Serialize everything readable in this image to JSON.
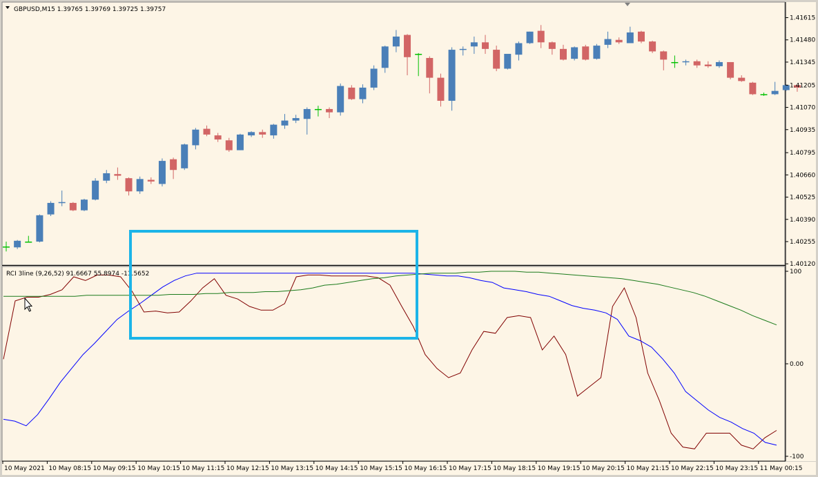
{
  "window": {
    "symbol_header": "GBPUSD,M15  1.39765 1.39769 1.39725 1.39757",
    "indicator_header": "RCI 3line (9,26,52) 91.6667 55.8974 -11.5652"
  },
  "colors": {
    "background": "#fdf5e6",
    "bull": "#4a7fb8",
    "bear": "#d26565",
    "doji": "#00c000",
    "rci_short": "#800000",
    "rci_mid": "#0000ff",
    "rci_long": "#1a7a1a",
    "highlight_box": "#1cb4e8"
  },
  "chart_data": [
    {
      "type": "candlestick",
      "title": "GBPUSD,M15",
      "ylim": [
        1.40125,
        1.41655
      ],
      "y_ticks": [
        "1.41615",
        "1.41480",
        "1.41345",
        "1.41205",
        "1.41070",
        "1.40935",
        "1.40795",
        "1.40660",
        "1.40525",
        "1.40390",
        "1.40255",
        "1.40120"
      ],
      "x_ticks": [
        "10 May 2021",
        "10 May 08:15",
        "10 May 09:15",
        "10 May 10:15",
        "10 May 11:15",
        "10 May 12:15",
        "10 May 13:15",
        "10 May 14:15",
        "10 May 15:15",
        "10 May 16:15",
        "10 May 17:15",
        "10 May 18:15",
        "10 May 19:15",
        "10 May 20:15",
        "10 May 21:15",
        "10 May 22:15",
        "10 May 23:15",
        "11 May 00:15"
      ],
      "candles": [
        {
          "o": 1.40225,
          "h": 1.40255,
          "l": 1.40195,
          "c": 1.40225
        },
        {
          "o": 1.4022,
          "h": 1.40265,
          "l": 1.4021,
          "c": 1.4026
        },
        {
          "o": 1.40255,
          "h": 1.4029,
          "l": 1.40255,
          "c": 1.40255
        },
        {
          "o": 1.40255,
          "h": 1.4042,
          "l": 1.4025,
          "c": 1.40415
        },
        {
          "o": 1.4042,
          "h": 1.405,
          "l": 1.4041,
          "c": 1.4049
        },
        {
          "o": 1.4049,
          "h": 1.40565,
          "l": 1.4047,
          "c": 1.40495
        },
        {
          "o": 1.4049,
          "h": 1.40495,
          "l": 1.4044,
          "c": 1.40445
        },
        {
          "o": 1.40445,
          "h": 1.40515,
          "l": 1.4044,
          "c": 1.4051
        },
        {
          "o": 1.4051,
          "h": 1.4064,
          "l": 1.40505,
          "c": 1.40625
        },
        {
          "o": 1.40625,
          "h": 1.4069,
          "l": 1.4061,
          "c": 1.4067
        },
        {
          "o": 1.40665,
          "h": 1.40705,
          "l": 1.4063,
          "c": 1.40655
        },
        {
          "o": 1.4064,
          "h": 1.40645,
          "l": 1.40535,
          "c": 1.4056
        },
        {
          "o": 1.4056,
          "h": 1.4065,
          "l": 1.40545,
          "c": 1.40635
        },
        {
          "o": 1.4063,
          "h": 1.40645,
          "l": 1.40605,
          "c": 1.4062
        },
        {
          "o": 1.40605,
          "h": 1.4076,
          "l": 1.4059,
          "c": 1.40745
        },
        {
          "o": 1.40755,
          "h": 1.40765,
          "l": 1.40635,
          "c": 1.4069
        },
        {
          "o": 1.407,
          "h": 1.4085,
          "l": 1.4069,
          "c": 1.40845
        },
        {
          "o": 1.4084,
          "h": 1.40945,
          "l": 1.40815,
          "c": 1.40935
        },
        {
          "o": 1.4094,
          "h": 1.4096,
          "l": 1.40895,
          "c": 1.40905
        },
        {
          "o": 1.409,
          "h": 1.40915,
          "l": 1.4086,
          "c": 1.40875
        },
        {
          "o": 1.4087,
          "h": 1.40885,
          "l": 1.408,
          "c": 1.4081
        },
        {
          "o": 1.4081,
          "h": 1.4091,
          "l": 1.4081,
          "c": 1.40905
        },
        {
          "o": 1.409,
          "h": 1.40925,
          "l": 1.4089,
          "c": 1.4092
        },
        {
          "o": 1.4092,
          "h": 1.40935,
          "l": 1.40885,
          "c": 1.40905
        },
        {
          "o": 1.409,
          "h": 1.4097,
          "l": 1.4088,
          "c": 1.40965
        },
        {
          "o": 1.4096,
          "h": 1.4103,
          "l": 1.4094,
          "c": 1.4099
        },
        {
          "o": 1.4099,
          "h": 1.41025,
          "l": 1.40975,
          "c": 1.41005
        },
        {
          "o": 1.41,
          "h": 1.4107,
          "l": 1.40905,
          "c": 1.4106
        },
        {
          "o": 1.4106,
          "h": 1.4108,
          "l": 1.41015,
          "c": 1.4106
        },
        {
          "o": 1.4106,
          "h": 1.4107,
          "l": 1.41005,
          "c": 1.4104
        },
        {
          "o": 1.4104,
          "h": 1.41215,
          "l": 1.4102,
          "c": 1.412
        },
        {
          "o": 1.4119,
          "h": 1.41205,
          "l": 1.41115,
          "c": 1.4112
        },
        {
          "o": 1.4112,
          "h": 1.4121,
          "l": 1.41095,
          "c": 1.4119
        },
        {
          "o": 1.4119,
          "h": 1.41325,
          "l": 1.41175,
          "c": 1.41305
        },
        {
          "o": 1.4131,
          "h": 1.41445,
          "l": 1.4128,
          "c": 1.4144
        },
        {
          "o": 1.4144,
          "h": 1.4154,
          "l": 1.41405,
          "c": 1.415
        },
        {
          "o": 1.4151,
          "h": 1.41515,
          "l": 1.41265,
          "c": 1.41375
        },
        {
          "o": 1.41395,
          "h": 1.414,
          "l": 1.4126,
          "c": 1.41395
        },
        {
          "o": 1.4137,
          "h": 1.4138,
          "l": 1.41155,
          "c": 1.4125
        },
        {
          "o": 1.4125,
          "h": 1.41275,
          "l": 1.41075,
          "c": 1.4111
        },
        {
          "o": 1.4111,
          "h": 1.41435,
          "l": 1.4105,
          "c": 1.4142
        },
        {
          "o": 1.4142,
          "h": 1.4144,
          "l": 1.41385,
          "c": 1.41425
        },
        {
          "o": 1.4144,
          "h": 1.415,
          "l": 1.41395,
          "c": 1.41465
        },
        {
          "o": 1.41465,
          "h": 1.4151,
          "l": 1.41395,
          "c": 1.41425
        },
        {
          "o": 1.4142,
          "h": 1.41445,
          "l": 1.4129,
          "c": 1.41305
        },
        {
          "o": 1.41305,
          "h": 1.4139,
          "l": 1.413,
          "c": 1.41395
        },
        {
          "o": 1.4139,
          "h": 1.4147,
          "l": 1.41355,
          "c": 1.4146
        },
        {
          "o": 1.4146,
          "h": 1.4153,
          "l": 1.41455,
          "c": 1.4153
        },
        {
          "o": 1.41535,
          "h": 1.4157,
          "l": 1.4143,
          "c": 1.41465
        },
        {
          "o": 1.41465,
          "h": 1.4147,
          "l": 1.4139,
          "c": 1.41425
        },
        {
          "o": 1.41425,
          "h": 1.4145,
          "l": 1.41355,
          "c": 1.4136
        },
        {
          "o": 1.41365,
          "h": 1.4144,
          "l": 1.41355,
          "c": 1.41435
        },
        {
          "o": 1.4144,
          "h": 1.4145,
          "l": 1.41355,
          "c": 1.4136
        },
        {
          "o": 1.41365,
          "h": 1.41455,
          "l": 1.4136,
          "c": 1.41445
        },
        {
          "o": 1.4145,
          "h": 1.4153,
          "l": 1.4143,
          "c": 1.41485
        },
        {
          "o": 1.4148,
          "h": 1.41495,
          "l": 1.41455,
          "c": 1.41465
        },
        {
          "o": 1.4146,
          "h": 1.4156,
          "l": 1.4146,
          "c": 1.41525
        },
        {
          "o": 1.4153,
          "h": 1.41535,
          "l": 1.4146,
          "c": 1.4147
        },
        {
          "o": 1.4147,
          "h": 1.41475,
          "l": 1.414,
          "c": 1.4141
        },
        {
          "o": 1.4141,
          "h": 1.41415,
          "l": 1.41295,
          "c": 1.4136
        },
        {
          "o": 1.41345,
          "h": 1.41385,
          "l": 1.4131,
          "c": 1.41345
        },
        {
          "o": 1.41345,
          "h": 1.4136,
          "l": 1.41325,
          "c": 1.4135
        },
        {
          "o": 1.4135,
          "h": 1.4136,
          "l": 1.4131,
          "c": 1.41325
        },
        {
          "o": 1.4133,
          "h": 1.4135,
          "l": 1.4131,
          "c": 1.4132
        },
        {
          "o": 1.4132,
          "h": 1.41355,
          "l": 1.4131,
          "c": 1.41345
        },
        {
          "o": 1.41345,
          "h": 1.41345,
          "l": 1.4124,
          "c": 1.4125
        },
        {
          "o": 1.4125,
          "h": 1.41265,
          "l": 1.41225,
          "c": 1.4123
        },
        {
          "o": 1.4122,
          "h": 1.41225,
          "l": 1.41145,
          "c": 1.4115
        },
        {
          "o": 1.4115,
          "h": 1.4116,
          "l": 1.4114,
          "c": 1.4115
        },
        {
          "o": 1.4115,
          "h": 1.41225,
          "l": 1.41145,
          "c": 1.4117
        },
        {
          "o": 1.41175,
          "h": 1.4121,
          "l": 1.4117,
          "c": 1.41205
        },
        {
          "o": 1.41205,
          "h": 1.41205,
          "l": 1.41165,
          "c": 1.4119
        }
      ]
    },
    {
      "type": "line",
      "title": "RCI 3line (9,26,52)",
      "ylim": [
        -100,
        100
      ],
      "y_ticks": [
        "100",
        "0.00",
        "-100"
      ],
      "series": [
        {
          "key": "short",
          "values": [
            5,
            68,
            72,
            72,
            75,
            80,
            94,
            90,
            96,
            96,
            94,
            78,
            56,
            57,
            55,
            56,
            68,
            82,
            92,
            74,
            70,
            62,
            58,
            58,
            65,
            94,
            96,
            96,
            95,
            95,
            95,
            95,
            93,
            85,
            62,
            40,
            10,
            -5,
            -15,
            -10,
            15,
            35,
            33,
            50,
            52,
            50,
            15,
            30,
            10,
            -35,
            -25,
            -15,
            62,
            82,
            50,
            -10,
            -40,
            -75,
            -90,
            -92,
            -75,
            -75,
            -75,
            -88,
            -92,
            -80,
            -72
          ]
        },
        {
          "key": "mid",
          "values": [
            -60,
            -62,
            -67,
            -55,
            -38,
            -20,
            -5,
            10,
            22,
            35,
            48,
            57,
            65,
            74,
            83,
            90,
            95,
            98,
            98,
            98,
            98,
            98,
            98,
            98,
            98,
            98,
            98,
            98,
            98,
            98,
            98,
            98,
            98,
            98,
            98,
            98,
            98,
            97,
            96,
            95,
            95,
            93,
            90,
            88,
            82,
            80,
            78,
            75,
            73,
            68,
            63,
            60,
            58,
            55,
            48,
            30,
            25,
            18,
            5,
            -10,
            -30,
            -40,
            -50,
            -58,
            -63,
            -70,
            -75,
            -85,
            -88
          ]
        },
        {
          "key": "long",
          "values": [
            73,
            73,
            73,
            73,
            73,
            73,
            73,
            74,
            74,
            74,
            74,
            74,
            74,
            74,
            75,
            75,
            75,
            76,
            76,
            77,
            77,
            77,
            78,
            78,
            79,
            80,
            82,
            85,
            86,
            88,
            90,
            92,
            93,
            95,
            96,
            97,
            98,
            98,
            98,
            99,
            99,
            100,
            100,
            100,
            99,
            99,
            98,
            97,
            96,
            95,
            94,
            93,
            92,
            90,
            88,
            86,
            83,
            80,
            77,
            73,
            68,
            63,
            58,
            52,
            47,
            42
          ]
        }
      ]
    }
  ]
}
